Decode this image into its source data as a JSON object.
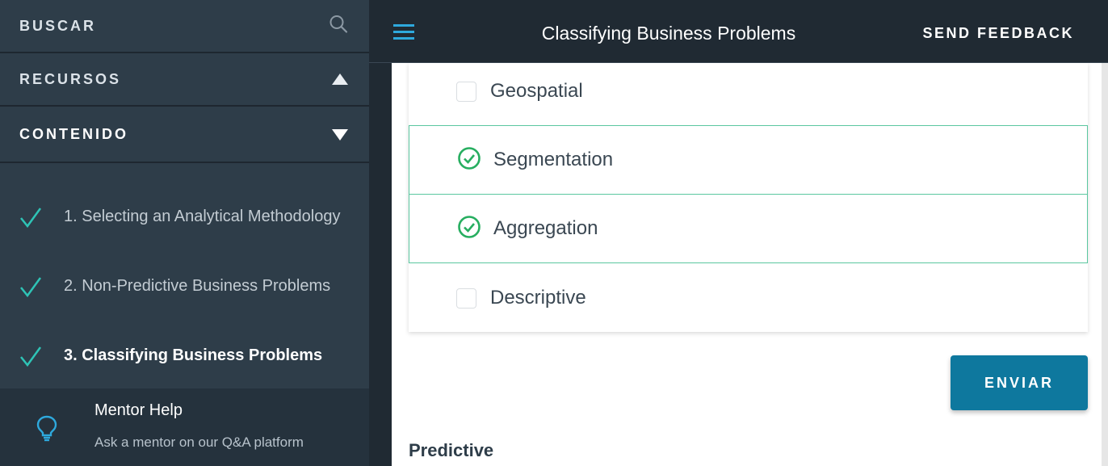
{
  "sidebar": {
    "search_label": "BUSCAR",
    "resources_label": "RECURSOS",
    "contents_label": "CONTENIDO",
    "lessons": [
      {
        "label": "1. Selecting an Analytical Methodology",
        "completed": true
      },
      {
        "label": "2. Non-Predictive Business Problems",
        "completed": true
      },
      {
        "label": "3. Classifying Business Problems",
        "completed": true,
        "active": true
      }
    ],
    "mentor": {
      "title": "Mentor Help",
      "subtitle": "Ask a mentor on our Q&A platform"
    }
  },
  "header": {
    "title": "Classifying Business Problems",
    "feedback_label": "SEND FEEDBACK"
  },
  "quiz": {
    "options": [
      {
        "label": "Geospatial",
        "checked": false
      },
      {
        "label": "Segmentation",
        "checked": true
      },
      {
        "label": "Aggregation",
        "checked": true
      },
      {
        "label": "Descriptive",
        "checked": false
      }
    ],
    "submit_label": "ENVIAR"
  },
  "next_section_heading": "Predictive",
  "colors": {
    "sidebar_bg": "#2e3d49",
    "header_bg": "#202a33",
    "accent_teal": "#2ec4b6",
    "check_green": "#27ae60",
    "submit_blue": "#0e789e"
  }
}
